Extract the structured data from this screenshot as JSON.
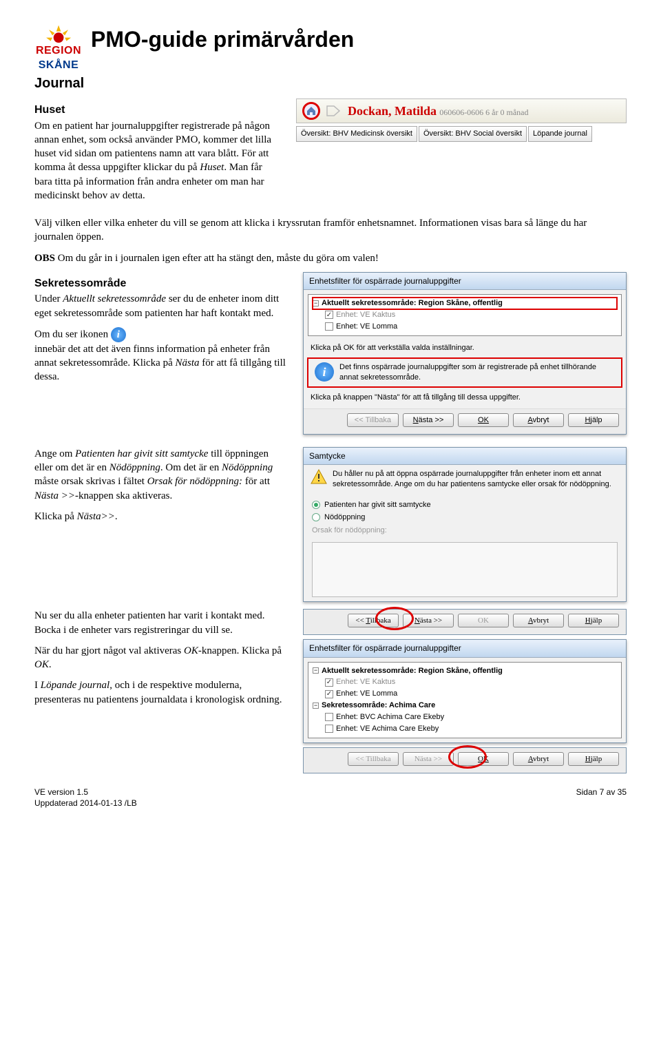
{
  "header": {
    "logo_top": "REGION",
    "logo_brand": "SKÅNE",
    "title": "PMO-guide primärvården",
    "section": "Journal"
  },
  "huset": {
    "heading": "Huset",
    "p1a": "Om en patient har journaluppgifter registrerade på någon annan enhet, som också använder PMO, kommer det lilla huset vid sidan om patientens namn att vara blått. För att komma åt dessa uppgifter klickar du på ",
    "p1b": ". Man får bara titta på information från andra enheter om man har medicinskt behov av detta.",
    "huset_word": "Huset",
    "p2": "Välj vilken eller vilka enheter du vill se genom att klicka i kryssrutan framför enhetsnamnet. Informationen visas bara så länge du har journalen öppen.",
    "p3_pre": "OBS",
    "p3": " Om du går in i journalen igen efter att ha stängt den, måste du göra om valen!"
  },
  "patient": {
    "name": "Dockan, Matilda",
    "details": "060606-0606 6 år 0 månad",
    "tab1": "Översikt: BHV Medicinsk översikt",
    "tab2": "Översikt: BHV Social översikt",
    "tab3": "Löpande journal"
  },
  "sekretess": {
    "heading": "Sekretessområde",
    "p1a": "Under ",
    "p1b": "Aktuellt sekretessområde",
    "p1c": " ser du de enheter inom ditt eget sekretessområde som patienten har haft kontakt med.",
    "p2a": "Om du ser ikonen ",
    "p2b": "innebär det att det även finns information på enheter från annat sekretessområde. Klicka på ",
    "p2c": "Nästa",
    "p2d": " för att få tillgång till dessa."
  },
  "dlg1": {
    "title": "Enhetsfilter för ospärrade journaluppgifter",
    "tree_top": "Aktuellt sekretessområde: Region Skåne, offentlig",
    "tree_item1": "Enhet: VE Kaktus",
    "tree_item2": "Enhet: VE Lomma",
    "msg_ok": "Klicka på OK för att verkställa valda inställningar.",
    "msg_info": "Det finns ospärrade journaluppgifter som är registrerade på enhet tillhörande annat sekretessområde.",
    "msg_next": "Klicka på knappen \"Nästa\" för att få tillgång till dessa uppgifter.",
    "btn_back": "Tillbaka",
    "btn_next": "Nästa >>",
    "btn_ok": "OK",
    "btn_cancel": "Avbryt",
    "btn_help": "Hjälp"
  },
  "samtycke": {
    "p1a": "Ange om ",
    "p1b": "Patienten har givit sitt samtycke",
    "p1c": " till öppningen eller om det är en ",
    "p1d": "Nödöppning",
    "p1e": ". Om det är en ",
    "p1f": "Nödöppning",
    "p1g": " måste orsak skrivas i fältet ",
    "p1h": "Orsak för nödöppning:",
    "p1i": " för att ",
    "p1j": "Nästa >>",
    "p1k": "-knappen ska aktiveras.",
    "p2a": "Klicka på ",
    "p2b": "Nästa>>",
    "p2c": "."
  },
  "dlg2": {
    "title": "Samtycke",
    "msg": "Du håller nu på att öppna ospärrade journaluppgifter från enheter inom ett annat sekretessområde. Ange om du har patientens samtycke eller orsak för nödöppning.",
    "opt1": "Patienten har givit sitt samtycke",
    "opt2": "Nödöppning",
    "orsak_lbl": "Orsak för nödöppning:"
  },
  "nu_ser": {
    "p1": "Nu ser du alla enheter patienten har varit i kontakt med. Bocka i de enheter vars registreringar du vill se.",
    "p2a": "När du har gjort något val aktiveras ",
    "p2b": "OK",
    "p2c": "-knappen. Klicka på ",
    "p2d": "OK",
    "p2e": ".",
    "p3a": "I ",
    "p3b": "Löpande journal",
    "p3c": ", och i de respektive modulerna, presenteras nu patientens journaldata i kronologisk ordning."
  },
  "dlg3": {
    "tree_top1": "Aktuellt sekretessområde: Region Skåne, offentlig",
    "tree_item1": "Enhet: VE Kaktus",
    "tree_item2": "Enhet: VE Lomma",
    "tree_top2": "Sekretessområde: Achima Care",
    "tree_item3": "Enhet: BVC Achima Care Ekeby",
    "tree_item4": "Enhet: VE Achima Care Ekeby"
  },
  "footer": {
    "left1": "VE version 1.5",
    "left2": "Uppdaterad 2014-01-13 /LB",
    "right": "Sidan 7 av 35"
  }
}
